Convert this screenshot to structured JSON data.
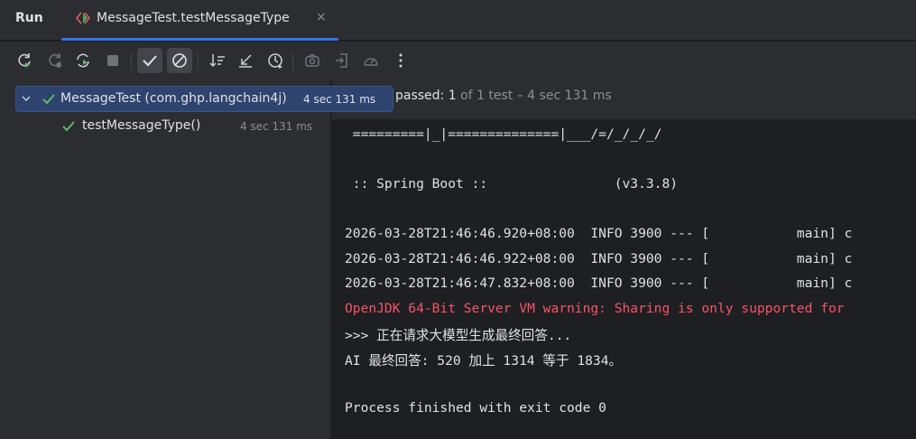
{
  "header": {
    "run_label": "Run",
    "tab_label": "MessageTest.testMessageType",
    "tab_close": "×"
  },
  "toolbar": {
    "buttons": [
      {
        "name": "rerun-icon",
        "active": false
      },
      {
        "name": "rerun-failed-icon",
        "active": false
      },
      {
        "name": "toggle-auto-test-icon",
        "active": false
      },
      {
        "name": "stop-icon",
        "active": false
      },
      {
        "name": "show-passed-icon",
        "active": true
      },
      {
        "name": "show-ignored-icon",
        "active": true
      },
      {
        "name": "sort-icon",
        "active": false
      },
      {
        "name": "collapse-icon",
        "active": false
      },
      {
        "name": "history-icon",
        "active": false
      },
      {
        "name": "camera-icon",
        "active": false
      },
      {
        "name": "export-icon",
        "active": false
      },
      {
        "name": "gauge-icon",
        "active": false
      },
      {
        "name": "more-vertical-icon",
        "active": false
      }
    ]
  },
  "tree": {
    "root": {
      "label": "MessageTest (com.ghp.langchain4j)",
      "time": "4 sec 131 ms"
    },
    "child": {
      "label": "testMessageType()",
      "time": "4 sec 131 ms"
    }
  },
  "status": {
    "passed": "passed: 1",
    "rest": "of 1 test – 4 sec 131 ms"
  },
  "console": {
    "lines": [
      {
        "text": " =========|_|==============|___/=/_/_/_/",
        "type": "normal"
      },
      {
        "text": "",
        "type": "normal"
      },
      {
        "text": " :: Spring Boot ::                (v3.3.8)",
        "type": "normal"
      },
      {
        "text": "",
        "type": "normal"
      },
      {
        "text": "2026-03-28T21:46:46.920+08:00  INFO 3900 --- [           main] c",
        "type": "normal"
      },
      {
        "text": "2026-03-28T21:46:46.922+08:00  INFO 3900 --- [           main] c",
        "type": "normal"
      },
      {
        "text": "2026-03-28T21:46:47.832+08:00  INFO 3900 --- [           main] c",
        "type": "normal"
      },
      {
        "text": "OpenJDK 64-Bit Server VM warning: Sharing is only supported for",
        "type": "err"
      },
      {
        "text": ">>> 正在请求大模型生成最终回答...",
        "type": "normal"
      },
      {
        "text": "AI 最终回答: 520 加上 1314 等于 1834。",
        "type": "normal"
      },
      {
        "text": "",
        "type": "normal"
      },
      {
        "text": "Process finished with exit code 0",
        "type": "normal"
      }
    ]
  },
  "colors": {
    "accent": "#3574f0",
    "pass_green": "#5fb865",
    "error_red": "#f75464"
  }
}
